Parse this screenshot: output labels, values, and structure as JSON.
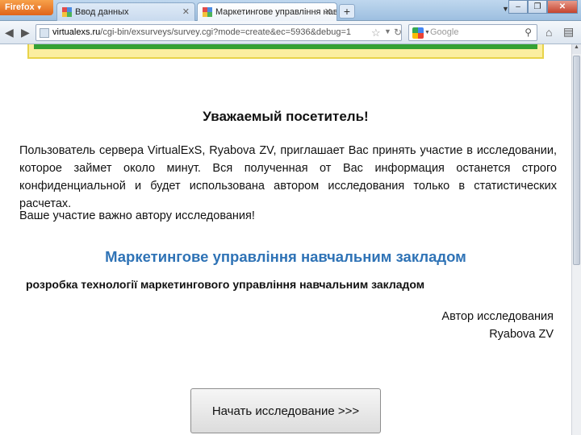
{
  "browser": {
    "menu_label": "Firefox",
    "tabs": [
      {
        "title": "Ввод данных"
      },
      {
        "title": "Маркетингове управління навчальн..."
      }
    ],
    "address": {
      "site": "virtualexs.ru",
      "path": "/cgi-bin/exsurveys/survey.cgi?mode=create&ec=5936&debug=1"
    },
    "search": {
      "placeholder": "Google"
    }
  },
  "page": {
    "greeting": "Уважаемый посетитель!",
    "intro": "Пользователь сервера VirtualExS, Ryabova ZV, приглашает Вас принять участие в исследовании, которое займет около минут. Вся полученная от Вас информация останется строго конфиденциальной и будет использована автором исследования только в статистических расчетах.",
    "importance": "Ваше участие важно автору исследования!",
    "survey_title": "Маркетингове управління навчальним закладом",
    "survey_subtitle": "розробка технології маркетингового управління навчальним закладом",
    "author_label": "Автор исследования",
    "author_name": "Ryabova ZV",
    "start_button": "Начать исследование >>>"
  },
  "colors": {
    "survey_title": "#2f73b6",
    "banner_fill": "#fbeea0",
    "banner_bar": "#34a134"
  }
}
